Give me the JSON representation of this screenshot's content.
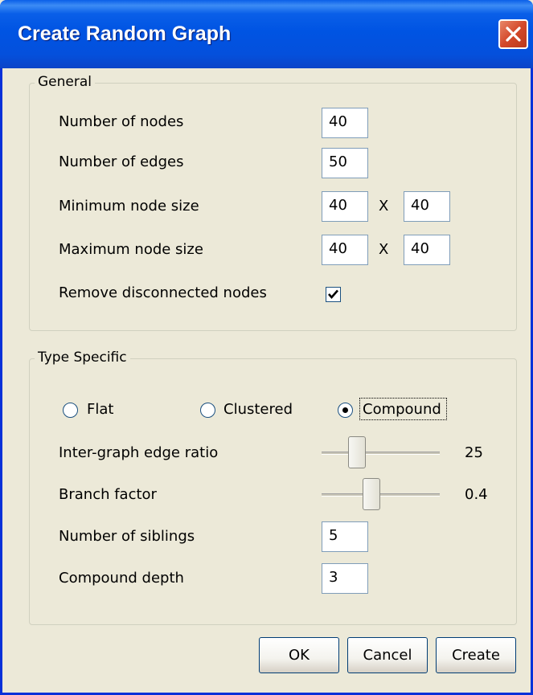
{
  "window": {
    "title": "Create Random Graph"
  },
  "general": {
    "legend": "General",
    "num_nodes": {
      "label": "Number of nodes",
      "value": "40"
    },
    "num_edges": {
      "label": "Number of edges",
      "value": "50"
    },
    "min_size": {
      "label": "Minimum node size",
      "width": "40",
      "sep": "X",
      "height": "40"
    },
    "max_size": {
      "label": "Maximum node size",
      "width": "40",
      "sep": "X",
      "height": "40"
    },
    "remove_disconnected": {
      "label": "Remove disconnected nodes",
      "checked": true
    }
  },
  "type_specific": {
    "legend": "Type Specific",
    "radios": [
      {
        "label": "Flat",
        "selected": false
      },
      {
        "label": "Clustered",
        "selected": false
      },
      {
        "label": "Compound",
        "selected": true
      }
    ],
    "inter_graph": {
      "label": "Inter-graph edge ratio",
      "value": "25",
      "level": 0.35
    },
    "branch": {
      "label": "Branch factor",
      "value": "0.4",
      "level": 0.42
    },
    "siblings": {
      "label": "Number of siblings",
      "value": "5"
    },
    "depth": {
      "label": "Compound depth",
      "value": "3"
    }
  },
  "buttons": {
    "ok": "OK",
    "cancel": "Cancel",
    "create": "Create"
  },
  "icons": {
    "close": "close-icon",
    "check": "check-icon"
  },
  "colors": {
    "title_bar": "#0054e3",
    "close_button": "#d4492a",
    "dialog_bg": "#ece9d8"
  }
}
